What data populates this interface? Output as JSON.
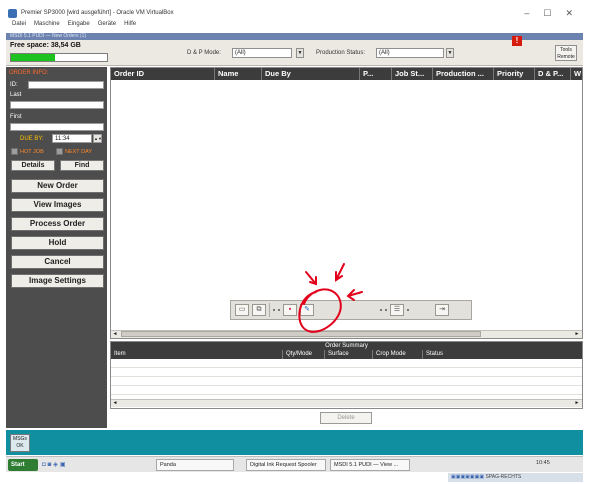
{
  "window": {
    "title": "Premier SP3000 [wird ausgeführt] - Oracle VM VirtualBox",
    "controls": {
      "minimize": "–",
      "maximize": "☐",
      "close": "✕"
    }
  },
  "vm_menu": [
    "Datei",
    "Maschine",
    "Eingabe",
    "Geräte",
    "Hilfe"
  ],
  "guest_title": "MSDI 5.1 PUDI — New Orders (1)",
  "toolbar": {
    "free_space": "Free space: 38,54 GB",
    "free_space_fraction": 0.46,
    "dp_mode_label": "D & P Mode:",
    "dp_mode_value": "(All)",
    "prod_status_label": "Production Status:",
    "prod_status_value": "(All)",
    "alert_symbol": "!",
    "tools_label": "Tools",
    "tools_sub": "Remote"
  },
  "left_panel": {
    "order_info_label": "ORDER INFO:",
    "id_label": "ID:",
    "last_label": "Last",
    "first_label": "First",
    "due_by_label": "DUE BY:",
    "due_time": "11:34",
    "hot_job_label": "HOT JOB",
    "next_day_label": "NEXT DAY",
    "details_label": "Details",
    "find_label": "Find",
    "buttons": [
      "New Order",
      "View Images",
      "Process Order",
      "Hold",
      "Cancel",
      "Image Settings"
    ]
  },
  "grid": {
    "columns": [
      "Order ID",
      "Name",
      "Due By",
      "P...",
      "Job St...",
      "Production ...",
      "Priority",
      "D & P...",
      "W"
    ]
  },
  "summary": {
    "title": "Order Summary",
    "columns": [
      "Item",
      "Qty/Mode",
      "Surface",
      "Crop Mode",
      "Status"
    ]
  },
  "delete_label": "Delete",
  "message_btn": {
    "line1": "MSGs",
    "line2": "OK"
  },
  "taskbar": {
    "start": "Start",
    "tasks": [
      "Panda",
      "Digital Ink Request Spooler",
      "MSDI 5.1 PUDI — View ..."
    ],
    "tray_text": "SPAG-RECHTS",
    "clock": "10:45"
  },
  "accent": {
    "annotation": "#e3001b",
    "teal": "#0f8fa0",
    "alert": "#d61a0c"
  }
}
